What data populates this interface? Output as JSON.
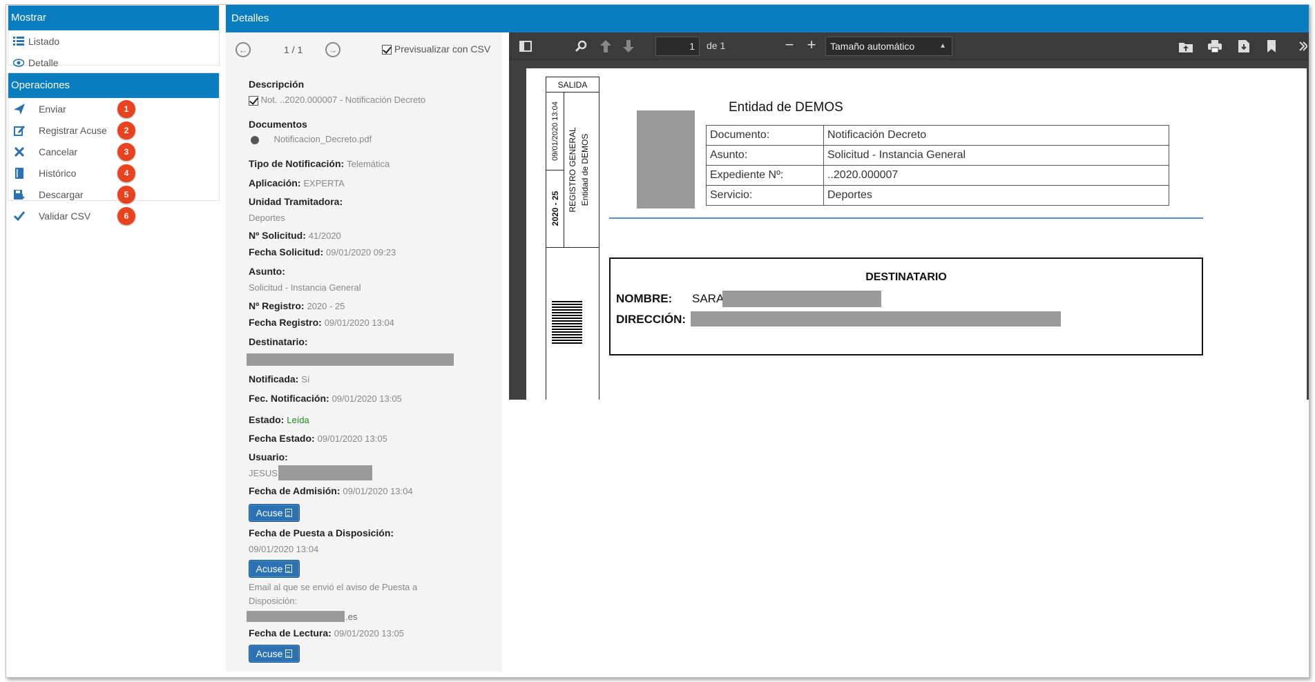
{
  "left": {
    "mostrar": {
      "title": "Mostrar",
      "items": [
        {
          "label": "Listado",
          "icon": "list-icon"
        },
        {
          "label": "Detalle",
          "icon": "eye-icon"
        }
      ]
    },
    "operaciones": {
      "title": "Operaciones",
      "items": [
        {
          "label": "Enviar",
          "icon": "send-icon",
          "badge": "1"
        },
        {
          "label": "Registrar Acuse",
          "icon": "edit-icon",
          "badge": "2"
        },
        {
          "label": "Cancelar",
          "icon": "close-icon",
          "badge": "3"
        },
        {
          "label": "Histórico",
          "icon": "book-icon",
          "badge": "4"
        },
        {
          "label": "Descargar",
          "icon": "download-icon",
          "badge": "5"
        },
        {
          "label": "Validar CSV",
          "icon": "check-icon",
          "badge": "6"
        }
      ]
    }
  },
  "detail": {
    "title": "Detalles",
    "pager": {
      "text": "1 / 1",
      "preview_label": "Previsualizar con CSV"
    },
    "descripcion_label": "Descripción",
    "descripcion_value": "Not. ..2020.000007 - Notificación Decreto",
    "documentos_label": "Documentos",
    "documento_file": "Notificacion_Decreto.pdf",
    "tipo_label": "Tipo de Notificación:",
    "tipo_value": "Telemática",
    "aplicacion_label": "Aplicación:",
    "aplicacion_value": "EXPERTA",
    "unidad_label": "Unidad Tramitadora:",
    "unidad_value": "Deportes",
    "solicitud_label": "Nº Solicitud:",
    "solicitud_value": "41/2020",
    "fecha_solicitud_label": "Fecha Solicitud:",
    "fecha_solicitud_value": "09/01/2020 09:23",
    "asunto_label": "Asunto:",
    "asunto_value": "Solicitud - Instancia General",
    "registro_label": "Nº Registro:",
    "registro_value": "2020 - 25",
    "fecha_registro_label": "Fecha Registro:",
    "fecha_registro_value": "09/01/2020 13:04",
    "destinatario_label": "Destinatario:",
    "notificada_label": "Notificada:",
    "notificada_value": "Sí",
    "fec_notif_label": "Fec. Notificación:",
    "fec_notif_value": "09/01/2020 13:05",
    "estado_label": "Estado:",
    "estado_value": "Leída",
    "estado_color": "#1a8a1a",
    "fecha_estado_label": "Fecha Estado:",
    "fecha_estado_value": "09/01/2020 13:05",
    "usuario_label": "Usuario:",
    "usuario_value": "JESUS",
    "fecha_admision_label": "Fecha de Admisión:",
    "fecha_admision_value": "09/01/2020 13:04",
    "acuse_label": "Acuse",
    "fecha_puesta_label": "Fecha de Puesta a Disposición:",
    "fecha_puesta_value": "09/01/2020 13:04",
    "email_text_1": "Email al que se envió el aviso de Puesta a",
    "email_text_2": "Disposición:",
    "email_suffix": ".es",
    "fecha_lectura_label": "Fecha de Lectura:",
    "fecha_lectura_value": "09/01/2020 13:05"
  },
  "viewer": {
    "page_value": "1",
    "page_total": "de 1",
    "zoom": "Tamaño automático",
    "doc": {
      "salida": "SALIDA",
      "stamp_date": "09/01/2020 13:04",
      "stamp_num": "2020 - 25",
      "stamp_reg": "REGISTRO GENERAL",
      "stamp_entity": "Entidad de DEMOS",
      "entity_title": "Entidad de DEMOS",
      "table": [
        [
          "Documento:",
          "Notificación Decreto"
        ],
        [
          "Asunto:",
          "Solicitud - Instancia General"
        ],
        [
          "Expediente Nº:",
          "..2020.000007"
        ],
        [
          "Servicio:",
          "Deportes"
        ]
      ],
      "dest_title": "DESTINATARIO",
      "nombre_label": "NOMBRE:",
      "nombre_value": "SARA",
      "direccion_label": "DIRECCIÓN:"
    }
  },
  "colors": {
    "accent": "#0a7dc0",
    "badge": "#e8421e",
    "button": "#2a72b3"
  }
}
